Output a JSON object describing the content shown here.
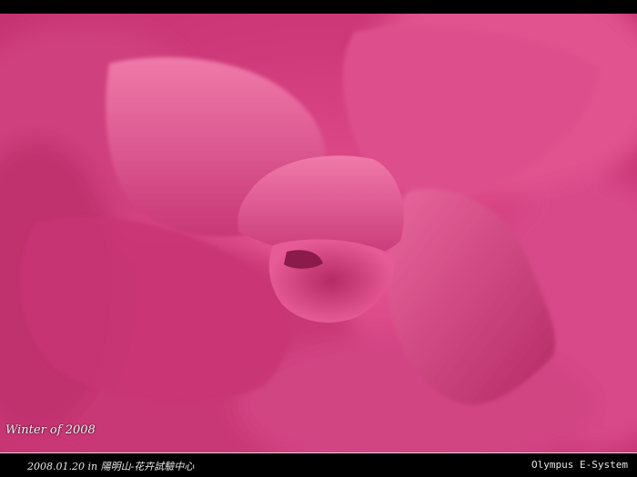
{
  "photo": {
    "subject": "pink-flower-macro",
    "colors": {
      "petal_main": "#d94584",
      "petal_light": "#f07aaa",
      "petal_shadow": "#b52a65",
      "center_dark": "#9a1f52"
    }
  },
  "caption": {
    "title": "Winter of 2008",
    "date_location": "2008.01.20 in 陽明山-花卉試驗中心",
    "camera": "Olympus E-System"
  }
}
